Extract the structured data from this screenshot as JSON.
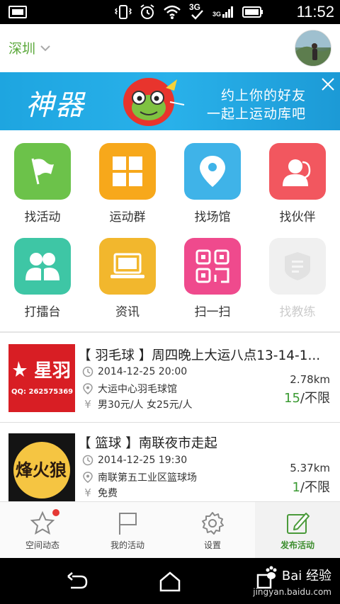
{
  "status_bar": {
    "time": "11:52",
    "network": "3G"
  },
  "header": {
    "city": "深圳"
  },
  "banner": {
    "brand": "神器",
    "line1": "约上你的好友",
    "line2": "一起上运动库吧"
  },
  "grid": [
    {
      "label": "找活动",
      "icon": "flag-icon",
      "color": "#6cc24a"
    },
    {
      "label": "运动群",
      "icon": "grid-icon",
      "color": "#f7a81b"
    },
    {
      "label": "找场馆",
      "icon": "location-pin-icon",
      "color": "#3fb3e8"
    },
    {
      "label": "找伙伴",
      "icon": "person-headset-icon",
      "color": "#f2575f"
    },
    {
      "label": "打擂台",
      "icon": "people-icon",
      "color": "#3ec6a5"
    },
    {
      "label": "资讯",
      "icon": "laptop-icon",
      "color": "#f2b72d"
    },
    {
      "label": "扫一扫",
      "icon": "qr-code-icon",
      "color": "#ef4a8d"
    },
    {
      "label": "找教练",
      "icon": "badge-icon",
      "color": "#f0f0f0"
    }
  ],
  "activities": [
    {
      "title": "【 羽毛球 】周四晚上大运八点13-14-1...",
      "thumb_text": "星羽",
      "thumb_sub": "QQ: 262575369",
      "datetime": "2014-12-25 20:00",
      "venue": "大运中心羽毛球馆",
      "price": "男30元/人  女25元/人",
      "distance": "2.78km",
      "joined": "15",
      "limit": "/不限"
    },
    {
      "title": "【 篮球 】南联夜市走起",
      "thumb_text": "烽火狼",
      "datetime": "2014-12-25 19:30",
      "venue": "南联第五工业区篮球场",
      "price": "免费",
      "distance": "5.37km",
      "joined": "1",
      "limit": "/不限"
    }
  ],
  "tabs": [
    {
      "label": "空间动态",
      "icon": "star-icon"
    },
    {
      "label": "我的活动",
      "icon": "flag-outline-icon"
    },
    {
      "label": "设置",
      "icon": "gear-icon"
    },
    {
      "label": "发布活动",
      "icon": "edit-icon"
    }
  ],
  "watermark": {
    "brand": "Bai 经验",
    "url": "jingyan.baidu.com"
  }
}
